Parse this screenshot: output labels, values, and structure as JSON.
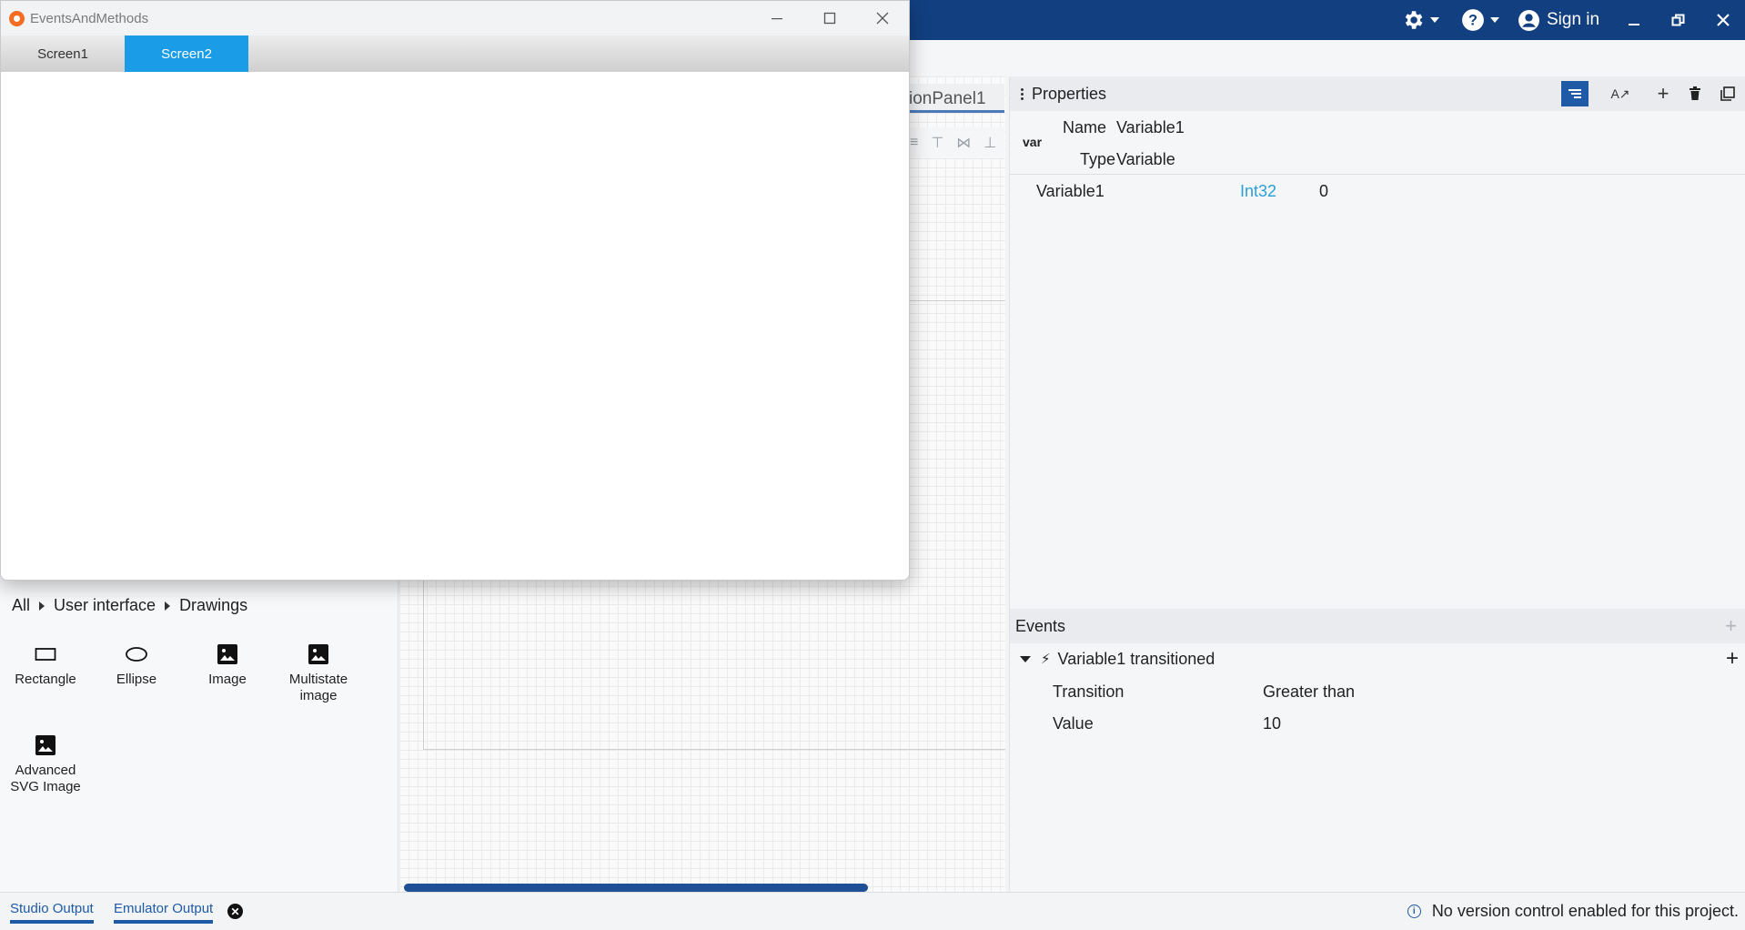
{
  "appbar": {
    "settings_icon": "gear-icon",
    "help_icon": "help-icon",
    "account_icon": "account-circle-icon",
    "signin_label": "Sign in",
    "bg_color": "#123f80"
  },
  "emulator": {
    "title": "EventsAndMethods",
    "tabs": [
      {
        "label": "Screen1",
        "selected": false
      },
      {
        "label": "Screen2",
        "selected": true
      }
    ],
    "accent_color": "#1a9ce6"
  },
  "canvas": {
    "tab_label": "ionPanel1"
  },
  "library": {
    "breadcrumb": [
      "All",
      "User interface",
      "Drawings"
    ],
    "items": [
      {
        "label": "Rectangle",
        "icon": "rectangle-icon"
      },
      {
        "label": "Ellipse",
        "icon": "ellipse-icon"
      },
      {
        "label": "Image",
        "icon": "image-icon"
      },
      {
        "label": "Multistate image",
        "icon": "image-icon"
      },
      {
        "label": "Advanced SVG Image",
        "icon": "image-icon"
      }
    ]
  },
  "properties": {
    "title": "Properties",
    "badge": "var",
    "name_label": "Name",
    "name_value": "Variable1",
    "type_label": "Type",
    "type_value": "Variable",
    "variable_row": {
      "name": "Variable1",
      "data_type": "Int32",
      "value": "0"
    },
    "data_type_color": "#2b9fd6"
  },
  "events": {
    "title": "Events",
    "event_name": "Variable1 transitioned",
    "rows": [
      {
        "label": "Transition",
        "value": "Greater than"
      },
      {
        "label": "Value",
        "value": "10"
      }
    ]
  },
  "statusbar": {
    "tabs": [
      "Studio Output",
      "Emulator Output"
    ],
    "message": "No version control enabled for this project."
  }
}
